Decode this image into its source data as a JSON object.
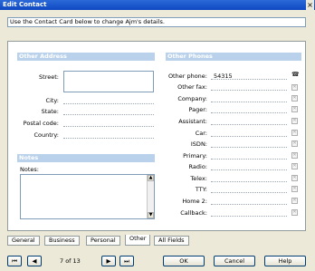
{
  "window": {
    "title": "Edit Contact",
    "close_glyph": "×"
  },
  "instructions": "Use the Contact Card below to change Ajm's details.",
  "other_address": {
    "header": "Other Address",
    "fields": [
      "Street:",
      "City:",
      "State:",
      "Postal code:",
      "Country:"
    ]
  },
  "notes": {
    "header": "Notes",
    "label": "Notes:"
  },
  "other_phones": {
    "header": "Other Phones",
    "fields": [
      {
        "label": "Other phone:",
        "value": "54315"
      },
      {
        "label": "Other fax:",
        "value": ""
      },
      {
        "label": "Company:",
        "value": ""
      },
      {
        "label": "Pager:",
        "value": ""
      },
      {
        "label": "Assistant:",
        "value": ""
      },
      {
        "label": "Car:",
        "value": ""
      },
      {
        "label": "ISDN:",
        "value": ""
      },
      {
        "label": "Primary:",
        "value": ""
      },
      {
        "label": "Radio:",
        "value": ""
      },
      {
        "label": "Telex:",
        "value": ""
      },
      {
        "label": "TTY:",
        "value": ""
      },
      {
        "label": "Home 2:",
        "value": ""
      },
      {
        "label": "Callback:",
        "value": ""
      }
    ]
  },
  "tabs": [
    "General",
    "Business",
    "Personal",
    "Other",
    "All Fields"
  ],
  "active_tab": "Other",
  "navigation": {
    "first": "⏮",
    "prev": "◀",
    "position": "7 of 13",
    "next": "▶",
    "last": "⏭"
  },
  "buttons": {
    "ok": "OK",
    "cancel": "Cancel",
    "help": "Help"
  },
  "icons": {
    "phone": "phone-icon",
    "clear": "clear-icon"
  }
}
